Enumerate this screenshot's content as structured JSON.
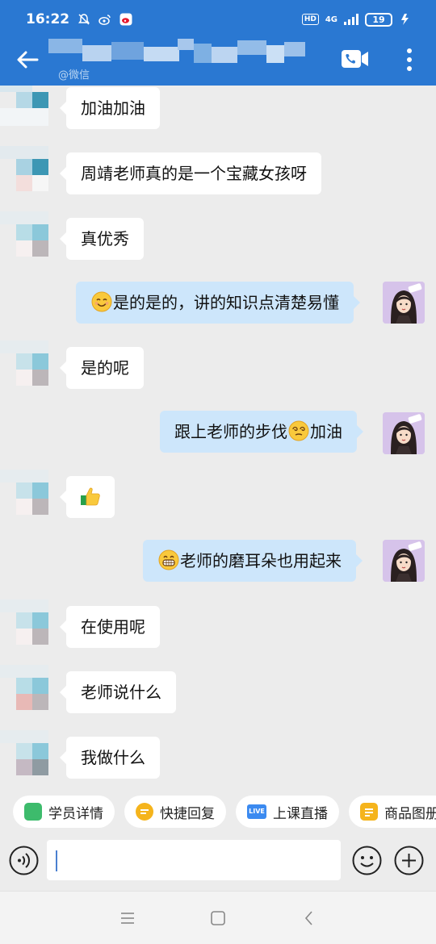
{
  "status_bar": {
    "time": "16:22",
    "network": "4G",
    "hd_label": "HD",
    "battery": "19"
  },
  "header": {
    "subtitle": "@微信",
    "accent_color": "#2a78d2",
    "icons": [
      "back-arrow-icon",
      "video-call-icon",
      "more-vertical-icon"
    ]
  },
  "messages": [
    {
      "side": "in",
      "text": "加油加油"
    },
    {
      "side": "in",
      "text": "周靖老师真的是一个宝藏女孩呀"
    },
    {
      "side": "in",
      "text": "真优秀"
    },
    {
      "side": "out",
      "emoji_before": "smiling-face",
      "text": "是的是的，讲的知识点清楚易懂"
    },
    {
      "side": "in",
      "text": "是的呢"
    },
    {
      "side": "out",
      "text_before": "跟上老师的步伐",
      "emoji": "dizzy-face",
      "text_after": "加油"
    },
    {
      "side": "in",
      "emoji_only": "thumbs-up"
    },
    {
      "side": "out",
      "emoji_before": "grinning-face",
      "text": "老师的磨耳朵也用起来"
    },
    {
      "side": "in",
      "text": "在使用呢"
    },
    {
      "side": "in",
      "text": "老师说什么"
    },
    {
      "side": "in",
      "text": "我做什么"
    }
  ],
  "quick_actions": [
    {
      "label": "学员详情",
      "icon": "student-info-icon",
      "color": "#3dbb6c"
    },
    {
      "label": "快捷回复",
      "icon": "quick-reply-icon",
      "color": "#f5b41c"
    },
    {
      "label": "上课直播",
      "icon": "live-icon",
      "color": "#3b8af0",
      "badge": "LIVE"
    },
    {
      "label": "商品图册",
      "icon": "catalog-icon",
      "color": "#f5b41c"
    }
  ],
  "input": {
    "value": "",
    "placeholder": ""
  }
}
